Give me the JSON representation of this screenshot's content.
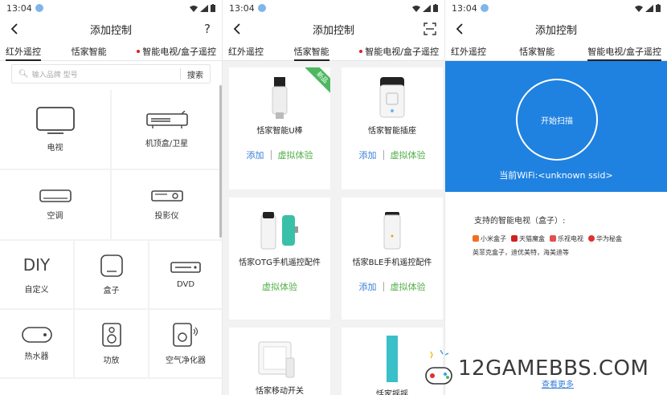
{
  "status": {
    "time": "13:04"
  },
  "panel1": {
    "title": "添加控制",
    "help": "?",
    "tabs": [
      "红外遥控",
      "恬家智能",
      "智能电视/盒子遥控"
    ],
    "search": {
      "placeholder": "输入品牌 型号",
      "button": "搜索"
    },
    "devices": [
      "电视",
      "机顶盒/卫星",
      "空调",
      "投影仪",
      "自定义",
      "盒子",
      "DVD",
      "热水器",
      "功放",
      "空气净化器"
    ],
    "diy_text": "DIY"
  },
  "panel2": {
    "title": "添加控制",
    "tabs": [
      "红外遥控",
      "恬家智能",
      "智能电视/盒子遥控"
    ],
    "badge": "新品",
    "cards": [
      {
        "name": "恬家智能U棒",
        "add": "添加",
        "demo": "虚拟体验"
      },
      {
        "name": "恬家智能插座",
        "add": "添加",
        "demo": "虚拟体验"
      },
      {
        "name": "恬家OTG手机遥控配件",
        "demo": "虚拟体验"
      },
      {
        "name": "恬家BLE手机遥控配件",
        "add": "添加",
        "demo": "虚拟体验"
      },
      {
        "name": "恬家移动开关"
      },
      {
        "name": "恬家摇摇"
      }
    ]
  },
  "panel3": {
    "title": "添加控制",
    "tabs": [
      "红外遥控",
      "恬家智能",
      "智能电视/盒子遥控"
    ],
    "scan_button": "开始扫描",
    "wifi": "当前WiFi:<unknown ssid>",
    "support_title": "支持的智能电视（盒子）:",
    "brands": [
      "小米盒子",
      "天猫魔盒",
      "乐视电视",
      "华为秘盒"
    ],
    "brands_line2": "英菲克盒子，迪优美特，海美迪等",
    "scan_link": "查看更多"
  },
  "watermark": "12GAMEBBS.COM",
  "colors": {
    "blue": "#1f82e0",
    "green": "#54b04a",
    "link": "#3a7fd5",
    "red_dot": "#e02020"
  }
}
